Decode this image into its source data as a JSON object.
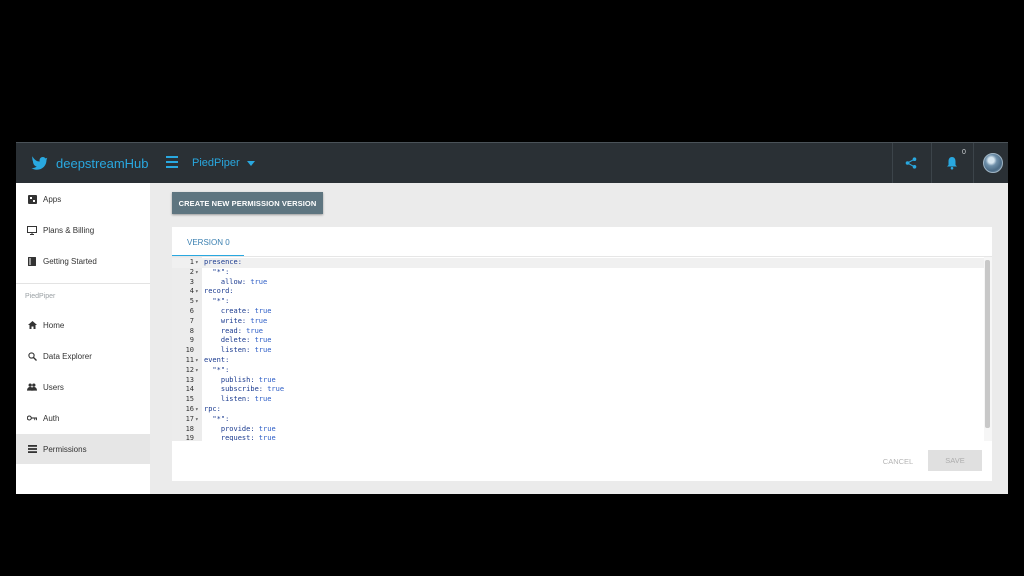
{
  "header": {
    "brand": "deepstreamHub",
    "app_name": "PiedPiper",
    "notification_count": "0"
  },
  "sidebar": {
    "top_items": [
      {
        "label": "Apps",
        "icon": "apps-icon"
      },
      {
        "label": "Plans & Billing",
        "icon": "billing-icon"
      },
      {
        "label": "Getting Started",
        "icon": "book-icon"
      }
    ],
    "section_label": "PiedPiper",
    "app_items": [
      {
        "label": "Home",
        "icon": "home-icon"
      },
      {
        "label": "Data Explorer",
        "icon": "search-icon"
      },
      {
        "label": "Users",
        "icon": "users-icon"
      },
      {
        "label": "Auth",
        "icon": "key-icon"
      },
      {
        "label": "Permissions",
        "icon": "list-icon",
        "active": true
      }
    ]
  },
  "main": {
    "create_button": "CREATE NEW PERMISSION VERSION",
    "tab_label": "VERSION 0",
    "editor_lines": [
      {
        "n": "1",
        "fold": true,
        "key": "presence:",
        "val": ""
      },
      {
        "n": "2",
        "fold": true,
        "key": "  \"*\":",
        "val": ""
      },
      {
        "n": "3",
        "fold": false,
        "key": "    allow: ",
        "val": "true"
      },
      {
        "n": "4",
        "fold": true,
        "key": "record:",
        "val": ""
      },
      {
        "n": "5",
        "fold": true,
        "key": "  \"*\":",
        "val": ""
      },
      {
        "n": "6",
        "fold": false,
        "key": "    create: ",
        "val": "true"
      },
      {
        "n": "7",
        "fold": false,
        "key": "    write: ",
        "val": "true"
      },
      {
        "n": "8",
        "fold": false,
        "key": "    read: ",
        "val": "true"
      },
      {
        "n": "9",
        "fold": false,
        "key": "    delete: ",
        "val": "true"
      },
      {
        "n": "10",
        "fold": false,
        "key": "    listen: ",
        "val": "true"
      },
      {
        "n": "11",
        "fold": true,
        "key": "event:",
        "val": ""
      },
      {
        "n": "12",
        "fold": true,
        "key": "  \"*\":",
        "val": ""
      },
      {
        "n": "13",
        "fold": false,
        "key": "    publish: ",
        "val": "true"
      },
      {
        "n": "14",
        "fold": false,
        "key": "    subscribe: ",
        "val": "true"
      },
      {
        "n": "15",
        "fold": false,
        "key": "    listen: ",
        "val": "true"
      },
      {
        "n": "16",
        "fold": true,
        "key": "rpc:",
        "val": ""
      },
      {
        "n": "17",
        "fold": true,
        "key": "  \"*\":",
        "val": ""
      },
      {
        "n": "18",
        "fold": false,
        "key": "    provide: ",
        "val": "true"
      },
      {
        "n": "19",
        "fold": false,
        "key": "    request: ",
        "val": "true"
      }
    ],
    "cancel_label": "CANCEL",
    "save_label": "SAVE"
  },
  "colors": {
    "accent": "#29a8e0",
    "topbar": "#2a3035",
    "button": "#5e7580"
  }
}
